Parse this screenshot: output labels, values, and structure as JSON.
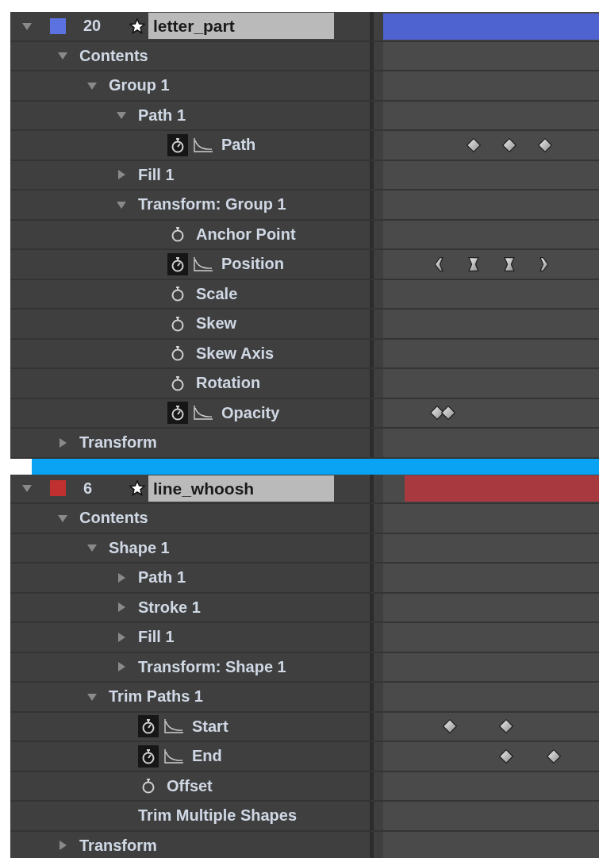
{
  "panels": [
    {
      "layer": {
        "expanded": true,
        "color": "#5b72e0",
        "number": "20",
        "name": "letter_part",
        "bar": {
          "color": "#4f63d0",
          "level": 1
        }
      },
      "children": [
        {
          "kind": "group",
          "label": "Contents",
          "expanded": true,
          "children": [
            {
              "kind": "group",
              "label": "Group 1",
              "expanded": true,
              "children": [
                {
                  "kind": "group",
                  "label": "Path 1",
                  "expanded": true,
                  "children": [
                    {
                      "kind": "property",
                      "label": "Path",
                      "animated": true,
                      "keyframes": [
                        {
                          "kind": "diamond",
                          "level": 0.42
                        },
                        {
                          "kind": "diamond",
                          "level": 0.585
                        },
                        {
                          "kind": "diamond",
                          "level": 0.75
                        }
                      ]
                    }
                  ]
                },
                {
                  "kind": "group",
                  "label": "Fill 1",
                  "expanded": false
                },
                {
                  "kind": "group",
                  "label": "Transform: Group 1",
                  "expanded": true,
                  "children": [
                    {
                      "kind": "property",
                      "label": "Anchor Point",
                      "animated": false
                    },
                    {
                      "kind": "property",
                      "label": "Position",
                      "animated": true,
                      "keyframes": [
                        {
                          "kind": "ease-out",
                          "level": 0.255
                        },
                        {
                          "kind": "ease",
                          "level": 0.42
                        },
                        {
                          "kind": "ease",
                          "level": 0.585
                        },
                        {
                          "kind": "ease-in",
                          "level": 0.75
                        }
                      ]
                    },
                    {
                      "kind": "property",
                      "label": "Scale",
                      "animated": false
                    },
                    {
                      "kind": "property",
                      "label": "Skew",
                      "animated": false
                    },
                    {
                      "kind": "property",
                      "label": "Skew Axis",
                      "animated": false
                    },
                    {
                      "kind": "property",
                      "label": "Rotation",
                      "animated": false
                    },
                    {
                      "kind": "property",
                      "label": "Opacity",
                      "animated": true,
                      "keyframes": [
                        {
                          "kind": "diamond",
                          "level": 0.25
                        },
                        {
                          "kind": "diamond",
                          "level": 0.3
                        }
                      ]
                    }
                  ]
                }
              ]
            }
          ]
        },
        {
          "kind": "group",
          "label": "Transform",
          "expanded": false
        }
      ]
    },
    {
      "layer": {
        "expanded": true,
        "color": "#c03030",
        "number": "6",
        "name": "line_whoosh",
        "bar": {
          "color": "#a8393e",
          "level": 0.9
        }
      },
      "children": [
        {
          "kind": "group",
          "label": "Contents",
          "expanded": true,
          "children": [
            {
              "kind": "group",
              "label": "Shape 1",
              "expanded": true,
              "children": [
                {
                  "kind": "group",
                  "label": "Path 1",
                  "expanded": false
                },
                {
                  "kind": "group",
                  "label": "Stroke 1",
                  "expanded": false
                },
                {
                  "kind": "group",
                  "label": "Fill 1",
                  "expanded": false
                },
                {
                  "kind": "group",
                  "label": "Transform: Shape 1",
                  "expanded": false
                }
              ]
            },
            {
              "kind": "group",
              "label": "Trim Paths 1",
              "expanded": true,
              "children": [
                {
                  "kind": "property",
                  "label": "Start",
                  "animated": true,
                  "keyframes": [
                    {
                      "kind": "diamond",
                      "level": 0.31
                    },
                    {
                      "kind": "diamond",
                      "level": 0.57
                    }
                  ]
                },
                {
                  "kind": "property",
                  "label": "End",
                  "animated": true,
                  "keyframes": [
                    {
                      "kind": "diamond",
                      "level": 0.57
                    },
                    {
                      "kind": "diamond",
                      "level": 0.79
                    }
                  ]
                },
                {
                  "kind": "property",
                  "label": "Offset",
                  "animated": false
                },
                {
                  "kind": "option",
                  "label": "Trim Multiple Shapes"
                }
              ]
            }
          ]
        },
        {
          "kind": "group",
          "label": "Transform",
          "expanded": false
        }
      ]
    }
  ]
}
